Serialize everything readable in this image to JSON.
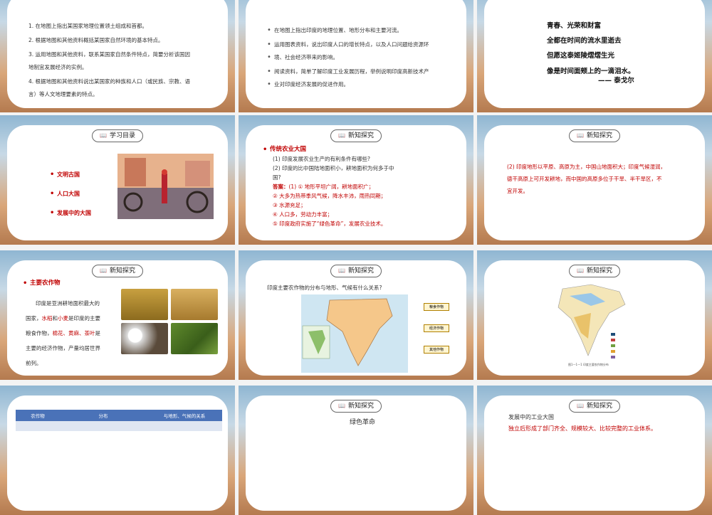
{
  "s1": {
    "items": [
      "1. 在地图上指出某国家地理位置领土组成和首都。",
      "2. 根据地图和其他资料概括某国家自然环境的基本特点。",
      "3. 运用地图和其他资料，联系某国家自然条件特点，简要分析该国因",
      "地制宜发展经济的实例。",
      "4. 根据地图和其他资料说出某国家的种族和人口（或民族、宗教、语",
      "言）等人文地理要素的特点。"
    ]
  },
  "s2": {
    "items": [
      "在地图上指出印度的地理位置、地形分布和主要河流。",
      "运用图表资料，说出印度人口的增长特点，以及人口问题给资源环",
      "境、社会经济带来的影响。",
      "阅读资料，简单了解印度工业发展历程，举例说明印度高新技术产",
      "业对印度经济发展的促进作用。"
    ]
  },
  "s3": {
    "lines": [
      "青春、光荣和财富",
      "全都在时间的流水里逝去",
      "但愿这泰姬陵熠熠生光",
      "像是时间面颊上的一滴泪水。",
      "—— 泰戈尔"
    ]
  },
  "s4": {
    "badge": "学习目录",
    "items": [
      "文明古国",
      "人口大国",
      "发展中的大国"
    ]
  },
  "s5": {
    "badge": "新知探究",
    "title": "传统农业大国",
    "q1": "(1) 印度发展农业生产的有利条件有哪些?",
    "q2a": "(2) 印度的比中国陆地面积小，耕地面积为何多于中",
    "q2b": "国?",
    "answer_label": "答案：",
    "a1": "(1) ① 地形平坦广阔，耕地面积广；",
    "a2": "② 大多为热带季风气候，降水丰沛，雨热同期；",
    "a3": "③ 水源充足；",
    "a4": "④ 人口多，劳动力丰富；",
    "a5": "⑤ 印度政府实施了“绿色革命”，发展农业技术。"
  },
  "s6": {
    "badge": "新知探究",
    "lines": [
      "(2) 印度地形以平原、高原为主，中国山地面积大；印度气候湿润，",
      "德干高原上可开发耕地，而中国的高原多位于干旱、半干旱区，不",
      "宜开发。"
    ]
  },
  "s7": {
    "badge": "新知探究",
    "title": "主要农作物",
    "p1": "印度是亚洲耕地面积最大的",
    "p2a": "国家，",
    "rice": "水稻",
    "and": "和",
    "wheat": "小麦",
    "p2b": "是印度的主要",
    "p3a": "粮食作物，",
    "cash": "棉花、黄麻、茶叶",
    "p3b": "是",
    "p4": "主要的经济作物，产量均居世界",
    "p5": "前列。"
  },
  "s8": {
    "badge": "新知探究",
    "question": "印度主要农作物的分布与地形、气候有什么关系?",
    "legend": [
      "粮食作物",
      "经济作物",
      "其他作物"
    ]
  },
  "s9": {
    "badge": "新知探究",
    "caption": "图1—1—1  印度主要农作物分布"
  },
  "s10": {
    "headers": [
      "农作物",
      "分布",
      "与地形、气候的关系"
    ]
  },
  "s11": {
    "badge": "新知探究",
    "title": "绿色革命"
  },
  "s12": {
    "badge": "新知探究",
    "line1": "发展中的工业大国",
    "line2": "独立后形成了部门齐全、规模较大、比较完整的工业体系。"
  },
  "colors": {
    "accent_red": "#c00000",
    "table_header": "#4a72b8"
  }
}
